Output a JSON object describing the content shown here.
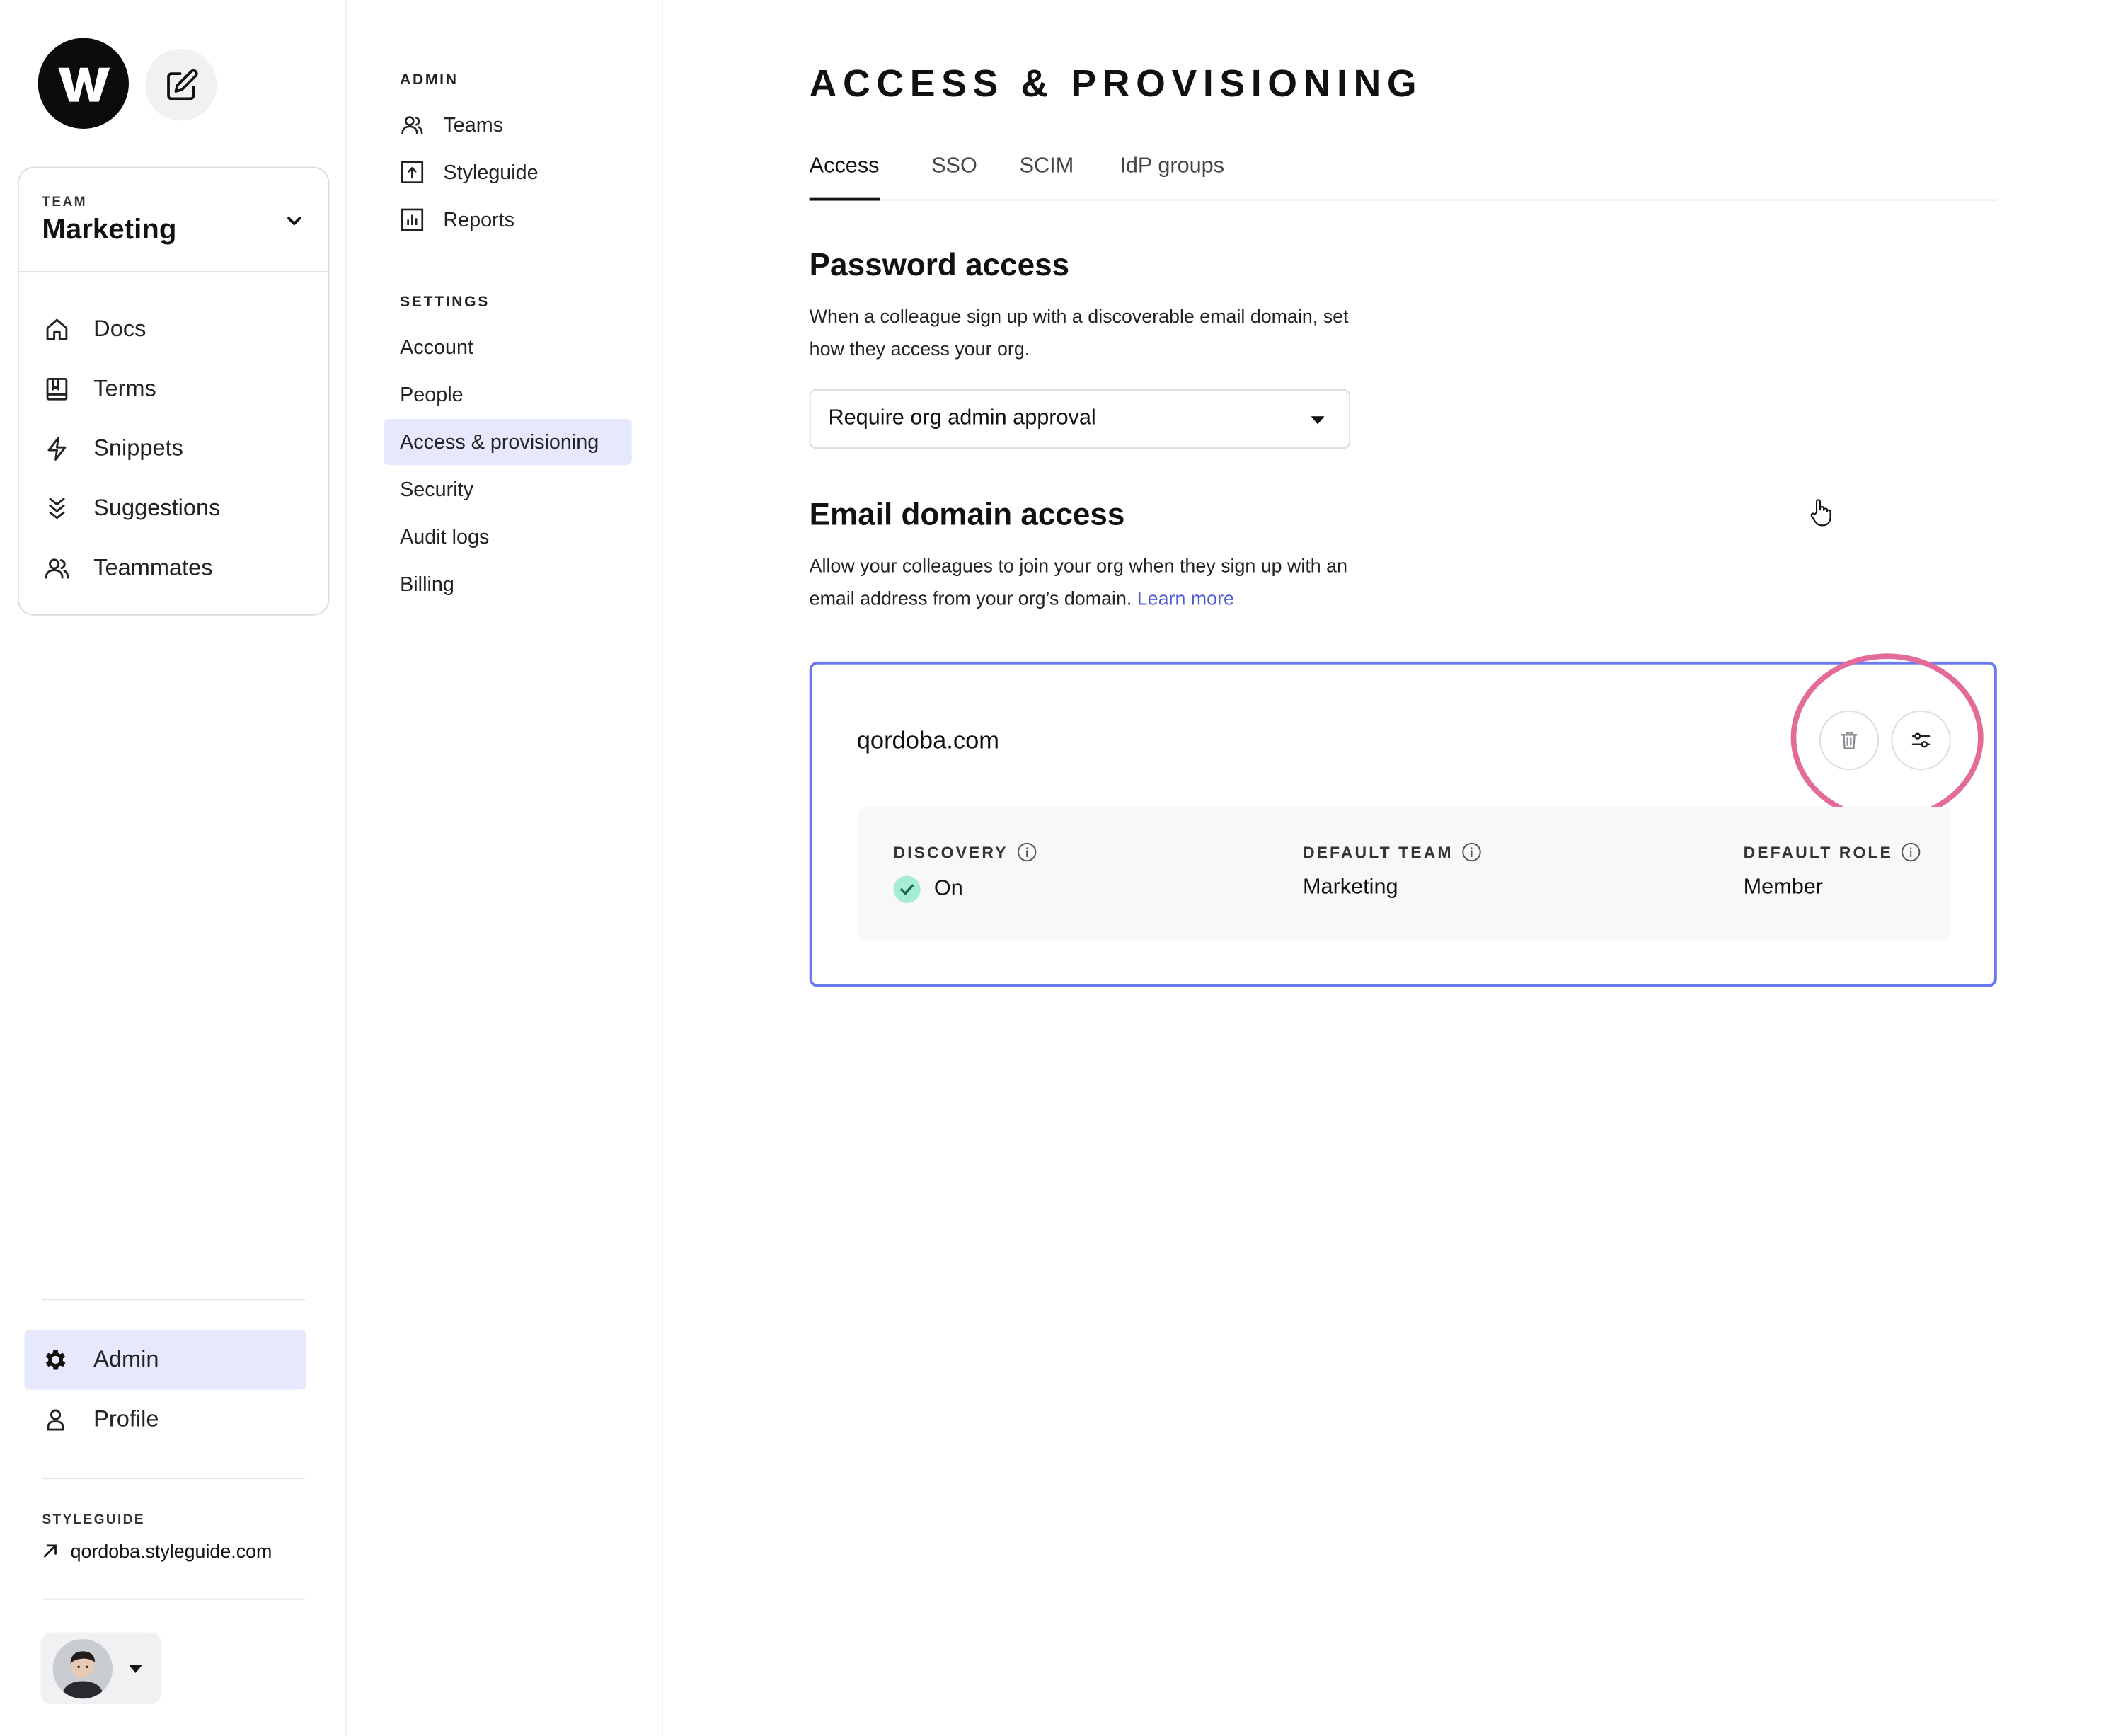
{
  "app": {
    "logo_letter": "W"
  },
  "sidebar": {
    "team_kicker": "TEAM",
    "team_name": "Marketing",
    "items": [
      {
        "label": "Docs",
        "icon": "home-icon"
      },
      {
        "label": "Terms",
        "icon": "book-icon"
      },
      {
        "label": "Snippets",
        "icon": "bolt-icon"
      },
      {
        "label": "Suggestions",
        "icon": "chevrons-down-icon"
      },
      {
        "label": "Teammates",
        "icon": "users-icon"
      }
    ],
    "bottom": [
      {
        "label": "Admin",
        "icon": "gear-icon",
        "active": true
      },
      {
        "label": "Profile",
        "icon": "person-icon",
        "active": false
      }
    ],
    "styleguide_kicker": "STYLEGUIDE",
    "styleguide_link": "qordoba.styleguide.com"
  },
  "settings_nav": {
    "admin_kicker": "ADMIN",
    "admin_items": [
      {
        "label": "Teams",
        "icon": "users-icon"
      },
      {
        "label": "Styleguide",
        "icon": "upload-box-icon"
      },
      {
        "label": "Reports",
        "icon": "bar-chart-icon"
      }
    ],
    "settings_kicker": "SETTINGS",
    "settings_items": [
      {
        "label": "Account"
      },
      {
        "label": "People"
      },
      {
        "label": "Access & provisioning",
        "active": true
      },
      {
        "label": "Security"
      },
      {
        "label": "Audit logs"
      },
      {
        "label": "Billing"
      }
    ]
  },
  "main": {
    "title": "ACCESS & PROVISIONING",
    "tabs": [
      {
        "label": "Access",
        "active": true
      },
      {
        "label": "SSO"
      },
      {
        "label": "SCIM"
      },
      {
        "label": "IdP groups"
      }
    ],
    "password": {
      "title": "Password access",
      "desc": "When a colleague sign up with a discoverable email domain, set how they access your org.",
      "select_value": "Require org admin approval"
    },
    "email": {
      "title": "Email domain access",
      "desc": "Allow your colleagues to join your org when they sign up with an email address from your org’s domain.",
      "learn_more": "Learn more"
    },
    "domain_card": {
      "domain": "qordoba.com",
      "discovery_label": "DISCOVERY",
      "discovery_value": "On",
      "default_team_label": "DEFAULT TEAM",
      "default_team_value": "Marketing",
      "default_role_label": "DEFAULT ROLE",
      "default_role_value": "Member"
    }
  },
  "colors": {
    "accent": "#6b7af0",
    "active_bg": "#e6e8fd",
    "link": "#4f5bd5",
    "highlight": "#e36b99",
    "success": "#a6ecd5"
  }
}
